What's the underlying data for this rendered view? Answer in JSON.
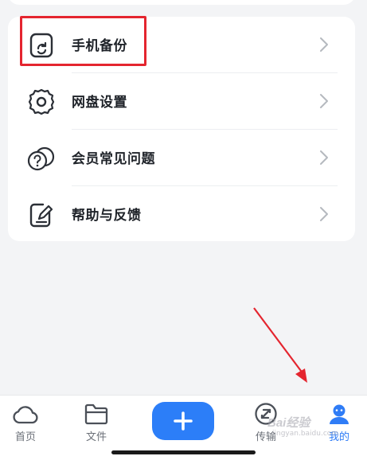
{
  "menu": {
    "items": [
      {
        "label": "手机备份",
        "icon": "phone-backup-icon"
      },
      {
        "label": "网盘设置",
        "icon": "gear-icon"
      },
      {
        "label": "会员常见问题",
        "icon": "faq-icon"
      },
      {
        "label": "帮助与反馈",
        "icon": "feedback-icon"
      }
    ]
  },
  "tabs": [
    {
      "label": "首页",
      "icon": "cloud-icon"
    },
    {
      "label": "文件",
      "icon": "folder-icon"
    },
    {
      "label": "传输",
      "icon": "transfer-icon"
    },
    {
      "label": "我的",
      "icon": "profile-icon",
      "active": true
    }
  ],
  "colors": {
    "accent": "#2c7ef8",
    "highlight": "#e4252f",
    "background": "#f3f4f6"
  },
  "watermark": {
    "text": "Bai经验",
    "url": "jingyan.baidu.com"
  }
}
